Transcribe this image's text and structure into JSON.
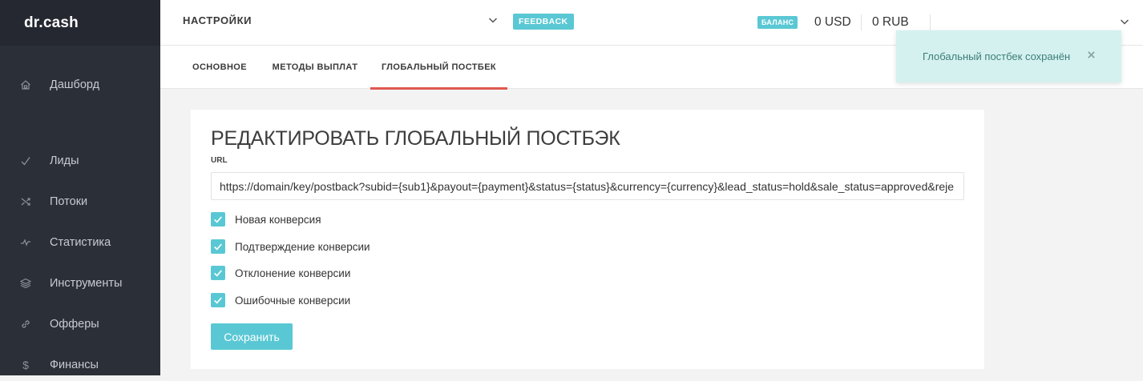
{
  "app": {
    "logo": "dr.cash"
  },
  "sidebar": {
    "items": [
      {
        "label": "Дашборд",
        "icon": "home-icon"
      },
      {
        "label": "Лиды",
        "icon": "check-icon"
      },
      {
        "label": "Потоки",
        "icon": "shuffle-icon"
      },
      {
        "label": "Статистика",
        "icon": "activity-icon"
      },
      {
        "label": "Инструменты",
        "icon": "layers-icon"
      },
      {
        "label": "Офферы",
        "icon": "link-icon"
      },
      {
        "label": "Финансы",
        "icon": "dollar-icon"
      }
    ]
  },
  "header": {
    "title": "НАСТРОЙКИ",
    "feedback_label": "FEEDBACK",
    "balance_label": "БАЛАНС",
    "balance_usd": "0 USD",
    "balance_rub": "0 RUB"
  },
  "tabs": [
    {
      "label": "ОСНОВНОЕ",
      "active": false
    },
    {
      "label": "МЕТОДЫ ВЫПЛАТ",
      "active": false
    },
    {
      "label": "ГЛОБАЛЬНЫЙ ПОСТБЕК",
      "active": true
    }
  ],
  "form": {
    "title": "РЕДАКТИРОВАТЬ ГЛОБАЛЬНЫЙ ПОСТБЭК",
    "url_label": "URL",
    "url_value": "https://domain/key/postback?subid={sub1}&payout={payment}&status={status}&currency={currency}&lead_status=hold&sale_status=approved&reje",
    "checkboxes": [
      {
        "label": "Новая конверсия",
        "checked": true
      },
      {
        "label": "Подтверждение конверсии",
        "checked": true
      },
      {
        "label": "Отклонение конверсии",
        "checked": true
      },
      {
        "label": "Ошибочные конверсии",
        "checked": true
      }
    ],
    "save_label": "Сохранить"
  },
  "toast": {
    "message": "Глобальный постбек сохранён"
  },
  "colors": {
    "accent": "#5ac8d4",
    "tab_active": "#e0574f",
    "sidebar_bg": "#2b2f38",
    "toast_bg": "#d4f1ef"
  }
}
